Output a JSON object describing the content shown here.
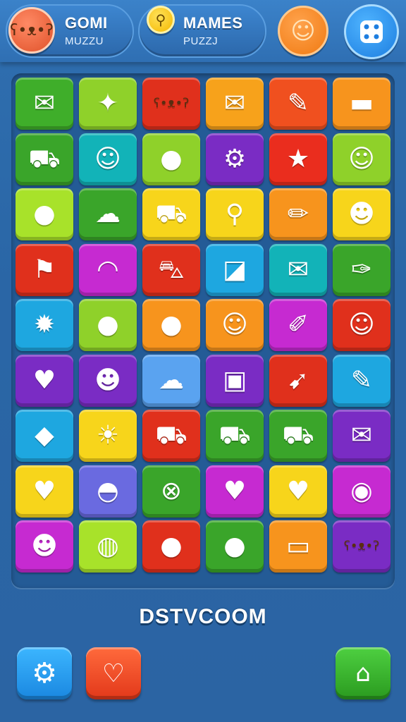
{
  "header": {
    "left_title": "GOMI",
    "left_subtitle": "MUZZU",
    "mid_title": "MAMES",
    "mid_subtitle": "PUZZJ",
    "left_avatar_icon": "bear-face-icon",
    "mid_avatar_icon": "magnifier-face-icon",
    "chat_icon": "chat-bubble-icon",
    "menu_icon": "dice-menu-icon"
  },
  "board": {
    "rows": [
      [
        {
          "icon": "envelope-icon",
          "glyph": "✉",
          "color": "#3fae2a"
        },
        {
          "icon": "satellite-icon",
          "glyph": "✦",
          "color": "#8fd12a"
        },
        {
          "icon": "bear-icon",
          "glyph": "ʕ•ᴥ•ʔ",
          "color": "#e0301c"
        },
        {
          "icon": "envelope-icon",
          "glyph": "✉",
          "color": "#f7a21b"
        },
        {
          "icon": "feather-icon",
          "glyph": "✎",
          "color": "#f0501f"
        },
        {
          "icon": "eraser-icon",
          "glyph": "▬",
          "color": "#f7941d"
        }
      ],
      [
        {
          "icon": "truck-icon",
          "glyph": "⛟",
          "color": "#3aa52a"
        },
        {
          "icon": "smiley-icon",
          "glyph": "☺",
          "color": "#12b3b8"
        },
        {
          "icon": "bean-icon",
          "glyph": "●",
          "color": "#8fd12a"
        },
        {
          "icon": "film-gear-icon",
          "glyph": "⚙",
          "color": "#7a2cc4"
        },
        {
          "icon": "star-card-icon",
          "glyph": "★",
          "color": "#ea2d1e"
        },
        {
          "icon": "smiley-icon",
          "glyph": "☺",
          "color": "#8fd12a"
        }
      ],
      [
        {
          "icon": "blob-icon",
          "glyph": "●",
          "color": "#a8e22a"
        },
        {
          "icon": "cloud-icon",
          "glyph": "☁",
          "color": "#3aa52a"
        },
        {
          "icon": "bus-icon",
          "glyph": "⛟",
          "color": "#f7d51b"
        },
        {
          "icon": "magnifier-icon",
          "glyph": "⚲",
          "color": "#f7d51b"
        },
        {
          "icon": "pencil-icon",
          "glyph": "✏",
          "color": "#f7941d"
        },
        {
          "icon": "ghost-face-icon",
          "glyph": "☻",
          "color": "#f7d51b"
        }
      ],
      [
        {
          "icon": "flag-icon",
          "glyph": "⚑",
          "color": "#e0301c"
        },
        {
          "icon": "banana-icon",
          "glyph": "◠",
          "color": "#c62ad1"
        },
        {
          "icon": "car-icon",
          "glyph": "⛍",
          "color": "#e0301c"
        },
        {
          "icon": "note-icon",
          "glyph": "◪",
          "color": "#1ea7e0"
        },
        {
          "icon": "envelope-icon",
          "glyph": "✉",
          "color": "#12b3b8"
        },
        {
          "icon": "spoon-icon",
          "glyph": "✑",
          "color": "#3aa52a"
        }
      ],
      [
        {
          "icon": "sun-gear-icon",
          "glyph": "✹",
          "color": "#1ea7e0"
        },
        {
          "icon": "orange-icon",
          "glyph": "●",
          "color": "#8fd12a"
        },
        {
          "icon": "plum-icon",
          "glyph": "●",
          "color": "#f7941d"
        },
        {
          "icon": "smiley-icon",
          "glyph": "☺",
          "color": "#f7941d"
        },
        {
          "icon": "pencil-star-icon",
          "glyph": "✐",
          "color": "#c62ad1"
        },
        {
          "icon": "smiley-badge-icon",
          "glyph": "☺",
          "color": "#e0301c"
        }
      ],
      [
        {
          "icon": "heart-icon",
          "glyph": "♥",
          "color": "#7a2cc4"
        },
        {
          "icon": "frog-icon",
          "glyph": "☻",
          "color": "#7a2cc4"
        },
        {
          "icon": "cloud-blob-icon",
          "glyph": "☁",
          "color": "#5aa3f0"
        },
        {
          "icon": "briefcase-icon",
          "glyph": "▣",
          "color": "#7a2cc4"
        },
        {
          "icon": "rocket-icon",
          "glyph": "➹",
          "color": "#e0301c"
        },
        {
          "icon": "lollipop-icon",
          "glyph": "✎",
          "color": "#1ea7e0"
        }
      ],
      [
        {
          "icon": "kite-icon",
          "glyph": "◆",
          "color": "#1ea7e0"
        },
        {
          "icon": "sun-face-icon",
          "glyph": "☀",
          "color": "#f7d51b"
        },
        {
          "icon": "bus-icon",
          "glyph": "⛟",
          "color": "#e0301c"
        },
        {
          "icon": "camper-icon",
          "glyph": "⛟",
          "color": "#3aa52a"
        },
        {
          "icon": "truck-icon",
          "glyph": "⛟",
          "color": "#3aa52a"
        },
        {
          "icon": "envelope-icon",
          "glyph": "✉",
          "color": "#7a2cc4"
        }
      ],
      [
        {
          "icon": "heart-icon",
          "glyph": "♥",
          "color": "#f7d51b"
        },
        {
          "icon": "hotdog-icon",
          "glyph": "◓",
          "color": "#6a6ae0"
        },
        {
          "icon": "globe-icon",
          "glyph": "⊗",
          "color": "#3aa52a"
        },
        {
          "icon": "calendar-heart-icon",
          "glyph": "♥",
          "color": "#c62ad1"
        },
        {
          "icon": "heart-bubble-icon",
          "glyph": "♥",
          "color": "#f7d51b"
        },
        {
          "icon": "witch-badge-icon",
          "glyph": "◉",
          "color": "#c62ad1"
        }
      ],
      [
        {
          "icon": "frog-bow-icon",
          "glyph": "☻",
          "color": "#c62ad1"
        },
        {
          "icon": "sushi-icon",
          "glyph": "◍",
          "color": "#a8e22a"
        },
        {
          "icon": "orange-leaf-icon",
          "glyph": "●",
          "color": "#e0301c"
        },
        {
          "icon": "hippo-icon",
          "glyph": "●",
          "color": "#3aa52a"
        },
        {
          "icon": "speech-monitor-icon",
          "glyph": "▭",
          "color": "#f7941d"
        },
        {
          "icon": "bear-icon",
          "glyph": "ʕ•ᴥ•ʔ",
          "color": "#7a2cc4"
        }
      ]
    ]
  },
  "footer": {
    "title": "DSTVCOOM",
    "settings_icon": "gear-icon",
    "favorite_icon": "heart-tag-icon",
    "home_icon": "home-icon"
  }
}
